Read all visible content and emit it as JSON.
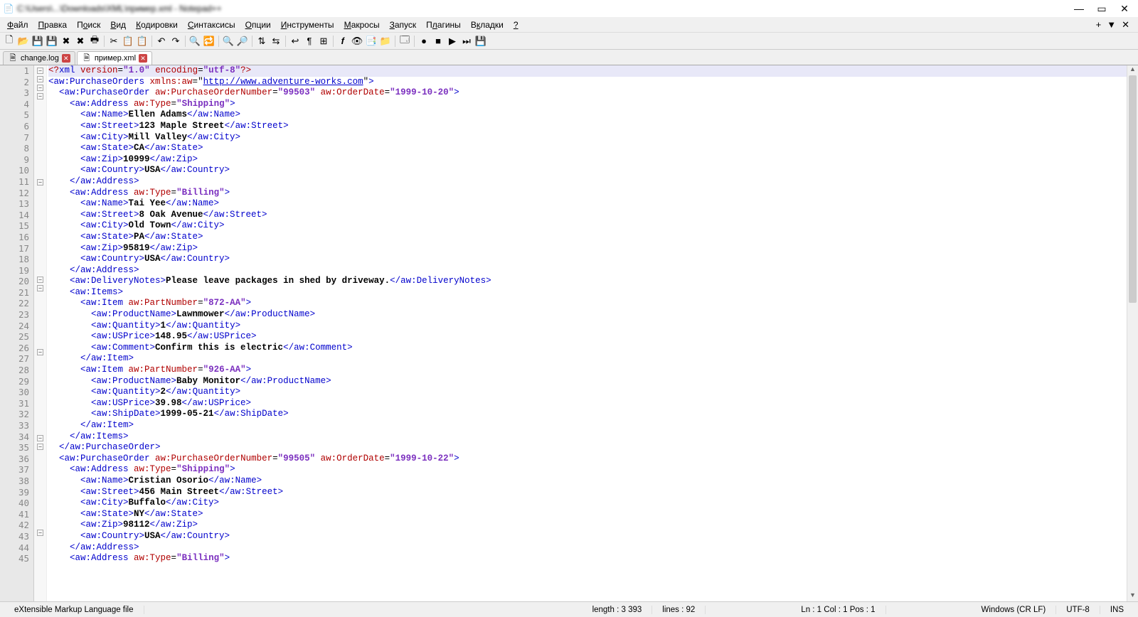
{
  "title_blur": "C:\\Users\\...\\Downloads\\XML\\пример.xml - Notepad++",
  "menus": [
    "Файл",
    "Правка",
    "Поиск",
    "Вид",
    "Кодировки",
    "Синтаксисы",
    "Опции",
    "Инструменты",
    "Макросы",
    "Запуск",
    "Плагины",
    "Вкладки",
    "?"
  ],
  "menus_ul": [
    "Ф",
    "П",
    "о",
    "В",
    "К",
    "С",
    "О",
    "И",
    "М",
    "З",
    "л",
    "к",
    "?"
  ],
  "tabs": [
    {
      "name": "change.log",
      "active": false
    },
    {
      "name": "пример.xml",
      "active": true
    }
  ],
  "code_lines": [
    {
      "n": 1,
      "fold": "-",
      "indent": 0,
      "seg": [
        [
          "pi",
          "<?"
        ],
        [
          "br",
          "xml "
        ],
        [
          "attr",
          "version"
        ],
        [
          "eq",
          "="
        ],
        [
          "str",
          "\"1.0\""
        ],
        [
          "br",
          " "
        ],
        [
          "attr",
          "encoding"
        ],
        [
          "eq",
          "="
        ],
        [
          "str",
          "\"utf-8\""
        ],
        [
          "pi",
          "?>"
        ]
      ],
      "current": true
    },
    {
      "n": 2,
      "fold": "-",
      "indent": 0,
      "seg": [
        [
          "br",
          "<aw:PurchaseOrders "
        ],
        [
          "attr",
          "xmlns:aw"
        ],
        [
          "eq",
          "="
        ],
        [
          "eq",
          "\""
        ],
        [
          "link",
          "http://www.adventure-works.com"
        ],
        [
          "eq",
          "\""
        ],
        [
          "br",
          ">"
        ]
      ]
    },
    {
      "n": 3,
      "fold": "-",
      "indent": 1,
      "seg": [
        [
          "br",
          "<aw:PurchaseOrder "
        ],
        [
          "attr",
          "aw:PurchaseOrderNumber"
        ],
        [
          "eq",
          "="
        ],
        [
          "str",
          "\"99503\""
        ],
        [
          "br",
          " "
        ],
        [
          "attr",
          "aw:OrderDate"
        ],
        [
          "eq",
          "="
        ],
        [
          "str",
          "\"1999-10-20\""
        ],
        [
          "br",
          ">"
        ]
      ]
    },
    {
      "n": 4,
      "fold": "-",
      "indent": 2,
      "seg": [
        [
          "br",
          "<aw:Address "
        ],
        [
          "attr",
          "aw:Type"
        ],
        [
          "eq",
          "="
        ],
        [
          "str",
          "\"Shipping\""
        ],
        [
          "br",
          ">"
        ]
      ]
    },
    {
      "n": 5,
      "fold": "",
      "indent": 3,
      "seg": [
        [
          "br",
          "<aw:Name>"
        ],
        [
          "txt",
          "Ellen Adams"
        ],
        [
          "br",
          "</aw:Name>"
        ]
      ]
    },
    {
      "n": 6,
      "fold": "",
      "indent": 3,
      "seg": [
        [
          "br",
          "<aw:Street>"
        ],
        [
          "txt",
          "123 Maple Street"
        ],
        [
          "br",
          "</aw:Street>"
        ]
      ]
    },
    {
      "n": 7,
      "fold": "",
      "indent": 3,
      "seg": [
        [
          "br",
          "<aw:City>"
        ],
        [
          "txt",
          "Mill Valley"
        ],
        [
          "br",
          "</aw:City>"
        ]
      ]
    },
    {
      "n": 8,
      "fold": "",
      "indent": 3,
      "seg": [
        [
          "br",
          "<aw:State>"
        ],
        [
          "txt",
          "CA"
        ],
        [
          "br",
          "</aw:State>"
        ]
      ]
    },
    {
      "n": 9,
      "fold": "",
      "indent": 3,
      "seg": [
        [
          "br",
          "<aw:Zip>"
        ],
        [
          "txt",
          "10999"
        ],
        [
          "br",
          "</aw:Zip>"
        ]
      ]
    },
    {
      "n": 10,
      "fold": "",
      "indent": 3,
      "seg": [
        [
          "br",
          "<aw:Country>"
        ],
        [
          "txt",
          "USA"
        ],
        [
          "br",
          "</aw:Country>"
        ]
      ]
    },
    {
      "n": 11,
      "fold": "",
      "indent": 2,
      "seg": [
        [
          "br",
          "</aw:Address>"
        ]
      ]
    },
    {
      "n": 12,
      "fold": "-",
      "indent": 2,
      "seg": [
        [
          "br",
          "<aw:Address "
        ],
        [
          "attr",
          "aw:Type"
        ],
        [
          "eq",
          "="
        ],
        [
          "str",
          "\"Billing\""
        ],
        [
          "br",
          ">"
        ]
      ]
    },
    {
      "n": 13,
      "fold": "",
      "indent": 3,
      "seg": [
        [
          "br",
          "<aw:Name>"
        ],
        [
          "txt",
          "Tai Yee"
        ],
        [
          "br",
          "</aw:Name>"
        ]
      ]
    },
    {
      "n": 14,
      "fold": "",
      "indent": 3,
      "seg": [
        [
          "br",
          "<aw:Street>"
        ],
        [
          "txt",
          "8 Oak Avenue"
        ],
        [
          "br",
          "</aw:Street>"
        ]
      ]
    },
    {
      "n": 15,
      "fold": "",
      "indent": 3,
      "seg": [
        [
          "br",
          "<aw:City>"
        ],
        [
          "txt",
          "Old Town"
        ],
        [
          "br",
          "</aw:City>"
        ]
      ]
    },
    {
      "n": 16,
      "fold": "",
      "indent": 3,
      "seg": [
        [
          "br",
          "<aw:State>"
        ],
        [
          "txt",
          "PA"
        ],
        [
          "br",
          "</aw:State>"
        ]
      ]
    },
    {
      "n": 17,
      "fold": "",
      "indent": 3,
      "seg": [
        [
          "br",
          "<aw:Zip>"
        ],
        [
          "txt",
          "95819"
        ],
        [
          "br",
          "</aw:Zip>"
        ]
      ]
    },
    {
      "n": 18,
      "fold": "",
      "indent": 3,
      "seg": [
        [
          "br",
          "<aw:Country>"
        ],
        [
          "txt",
          "USA"
        ],
        [
          "br",
          "</aw:Country>"
        ]
      ]
    },
    {
      "n": 19,
      "fold": "",
      "indent": 2,
      "seg": [
        [
          "br",
          "</aw:Address>"
        ]
      ]
    },
    {
      "n": 20,
      "fold": "",
      "indent": 2,
      "seg": [
        [
          "br",
          "<aw:DeliveryNotes>"
        ],
        [
          "txt",
          "Please leave packages in shed by driveway."
        ],
        [
          "br",
          "</aw:DeliveryNotes>"
        ]
      ]
    },
    {
      "n": 21,
      "fold": "-",
      "indent": 2,
      "seg": [
        [
          "br",
          "<aw:Items>"
        ]
      ]
    },
    {
      "n": 22,
      "fold": "-",
      "indent": 3,
      "seg": [
        [
          "br",
          "<aw:Item "
        ],
        [
          "attr",
          "aw:PartNumber"
        ],
        [
          "eq",
          "="
        ],
        [
          "str",
          "\"872-AA\""
        ],
        [
          "br",
          ">"
        ]
      ]
    },
    {
      "n": 23,
      "fold": "",
      "indent": 4,
      "seg": [
        [
          "br",
          "<aw:ProductName>"
        ],
        [
          "txt",
          "Lawnmower"
        ],
        [
          "br",
          "</aw:ProductName>"
        ]
      ]
    },
    {
      "n": 24,
      "fold": "",
      "indent": 4,
      "seg": [
        [
          "br",
          "<aw:Quantity>"
        ],
        [
          "txt",
          "1"
        ],
        [
          "br",
          "</aw:Quantity>"
        ]
      ]
    },
    {
      "n": 25,
      "fold": "",
      "indent": 4,
      "seg": [
        [
          "br",
          "<aw:USPrice>"
        ],
        [
          "txt",
          "148.95"
        ],
        [
          "br",
          "</aw:USPrice>"
        ]
      ]
    },
    {
      "n": 26,
      "fold": "",
      "indent": 4,
      "seg": [
        [
          "br",
          "<aw:Comment>"
        ],
        [
          "txt",
          "Confirm this is electric"
        ],
        [
          "br",
          "</aw:Comment>"
        ]
      ]
    },
    {
      "n": 27,
      "fold": "",
      "indent": 3,
      "seg": [
        [
          "br",
          "</aw:Item>"
        ]
      ]
    },
    {
      "n": 28,
      "fold": "-",
      "indent": 3,
      "seg": [
        [
          "br",
          "<aw:Item "
        ],
        [
          "attr",
          "aw:PartNumber"
        ],
        [
          "eq",
          "="
        ],
        [
          "str",
          "\"926-AA\""
        ],
        [
          "br",
          ">"
        ]
      ]
    },
    {
      "n": 29,
      "fold": "",
      "indent": 4,
      "seg": [
        [
          "br",
          "<aw:ProductName>"
        ],
        [
          "txt",
          "Baby Monitor"
        ],
        [
          "br",
          "</aw:ProductName>"
        ]
      ]
    },
    {
      "n": 30,
      "fold": "",
      "indent": 4,
      "seg": [
        [
          "br",
          "<aw:Quantity>"
        ],
        [
          "txt",
          "2"
        ],
        [
          "br",
          "</aw:Quantity>"
        ]
      ]
    },
    {
      "n": 31,
      "fold": "",
      "indent": 4,
      "seg": [
        [
          "br",
          "<aw:USPrice>"
        ],
        [
          "txt",
          "39.98"
        ],
        [
          "br",
          "</aw:USPrice>"
        ]
      ]
    },
    {
      "n": 32,
      "fold": "",
      "indent": 4,
      "seg": [
        [
          "br",
          "<aw:ShipDate>"
        ],
        [
          "txt",
          "1999-05-21"
        ],
        [
          "br",
          "</aw:ShipDate>"
        ]
      ]
    },
    {
      "n": 33,
      "fold": "",
      "indent": 3,
      "seg": [
        [
          "br",
          "</aw:Item>"
        ]
      ]
    },
    {
      "n": 34,
      "fold": "",
      "indent": 2,
      "seg": [
        [
          "br",
          "</aw:Items>"
        ]
      ]
    },
    {
      "n": 35,
      "fold": "",
      "indent": 1,
      "seg": [
        [
          "br",
          "</aw:PurchaseOrder>"
        ]
      ]
    },
    {
      "n": 36,
      "fold": "-",
      "indent": 1,
      "seg": [
        [
          "br",
          "<aw:PurchaseOrder "
        ],
        [
          "attr",
          "aw:PurchaseOrderNumber"
        ],
        [
          "eq",
          "="
        ],
        [
          "str",
          "\"99505\""
        ],
        [
          "br",
          " "
        ],
        [
          "attr",
          "aw:OrderDate"
        ],
        [
          "eq",
          "="
        ],
        [
          "str",
          "\"1999-10-22\""
        ],
        [
          "br",
          ">"
        ]
      ]
    },
    {
      "n": 37,
      "fold": "-",
      "indent": 2,
      "seg": [
        [
          "br",
          "<aw:Address "
        ],
        [
          "attr",
          "aw:Type"
        ],
        [
          "eq",
          "="
        ],
        [
          "str",
          "\"Shipping\""
        ],
        [
          "br",
          ">"
        ]
      ]
    },
    {
      "n": 38,
      "fold": "",
      "indent": 3,
      "seg": [
        [
          "br",
          "<aw:Name>"
        ],
        [
          "txt",
          "Cristian Osorio"
        ],
        [
          "br",
          "</aw:Name>"
        ]
      ]
    },
    {
      "n": 39,
      "fold": "",
      "indent": 3,
      "seg": [
        [
          "br",
          "<aw:Street>"
        ],
        [
          "txt",
          "456 Main Street"
        ],
        [
          "br",
          "</aw:Street>"
        ]
      ]
    },
    {
      "n": 40,
      "fold": "",
      "indent": 3,
      "seg": [
        [
          "br",
          "<aw:City>"
        ],
        [
          "txt",
          "Buffalo"
        ],
        [
          "br",
          "</aw:City>"
        ]
      ]
    },
    {
      "n": 41,
      "fold": "",
      "indent": 3,
      "seg": [
        [
          "br",
          "<aw:State>"
        ],
        [
          "txt",
          "NY"
        ],
        [
          "br",
          "</aw:State>"
        ]
      ]
    },
    {
      "n": 42,
      "fold": "",
      "indent": 3,
      "seg": [
        [
          "br",
          "<aw:Zip>"
        ],
        [
          "txt",
          "98112"
        ],
        [
          "br",
          "</aw:Zip>"
        ]
      ]
    },
    {
      "n": 43,
      "fold": "",
      "indent": 3,
      "seg": [
        [
          "br",
          "<aw:Country>"
        ],
        [
          "txt",
          "USA"
        ],
        [
          "br",
          "</aw:Country>"
        ]
      ]
    },
    {
      "n": 44,
      "fold": "",
      "indent": 2,
      "seg": [
        [
          "br",
          "</aw:Address>"
        ]
      ]
    },
    {
      "n": 45,
      "fold": "-",
      "indent": 2,
      "seg": [
        [
          "br",
          "<aw:Address "
        ],
        [
          "attr",
          "aw:Type"
        ],
        [
          "eq",
          "="
        ],
        [
          "str",
          "\"Billing\""
        ],
        [
          "br",
          ">"
        ]
      ]
    }
  ],
  "status": {
    "filetype": "eXtensible Markup Language file",
    "length": "length : 3 393",
    "lines": "lines : 92",
    "pos": "Ln : 1   Col : 1   Pos : 1",
    "eol": "Windows (CR LF)",
    "enc": "UTF-8",
    "ins": "INS"
  },
  "toolbar_icons": [
    "new-file-icon",
    "open-file-icon",
    "save-icon",
    "save-all-icon",
    "close-icon",
    "close-all-icon",
    "print-icon",
    "sep",
    "cut-icon",
    "copy-icon",
    "paste-icon",
    "sep",
    "undo-icon",
    "redo-icon",
    "sep",
    "find-icon",
    "replace-icon",
    "sep",
    "zoom-in-icon",
    "zoom-out-icon",
    "sep",
    "sync-v-icon",
    "sync-h-icon",
    "sep",
    "wordwrap-icon",
    "show-all-icon",
    "indent-guide-icon",
    "sep",
    "lang-icon",
    "doc-map-icon",
    "function-list-icon",
    "folder-icon",
    "sep",
    "monitor-icon",
    "sep",
    "record-macro-icon",
    "stop-macro-icon",
    "play-macro-icon",
    "play-multi-icon",
    "save-macro-icon"
  ]
}
